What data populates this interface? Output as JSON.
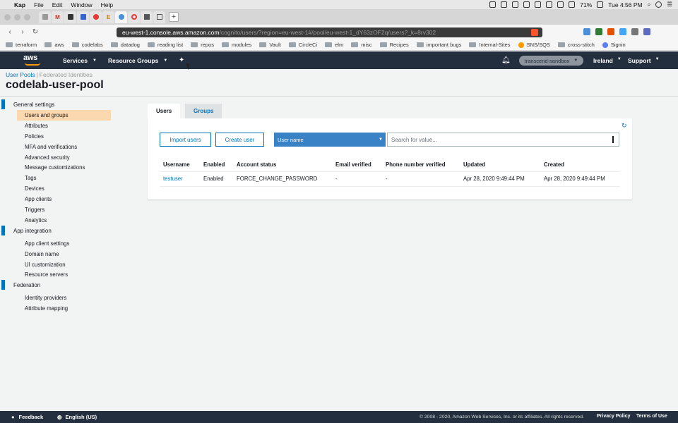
{
  "macos": {
    "menus": [
      "Kap",
      "File",
      "Edit",
      "Window",
      "Help"
    ],
    "battery": "71%",
    "clock": "Tue 4:56 PM"
  },
  "browser": {
    "tabs": [
      "",
      "M",
      "",
      "",
      "",
      "E",
      "",
      "",
      "",
      ""
    ],
    "url_host": "eu-west-1.console.aws.amazon.com",
    "url_path": "/cognito/users/?region=eu-west-1#/pool/eu-west-1_dY63zOF2q/users?_k=8rv302"
  },
  "bookmarks": [
    "terraform",
    "aws",
    "codelabs",
    "datadog",
    "reading list",
    "repos",
    "modules",
    "Vault",
    "CircleCi",
    "elm",
    "misc",
    "Recipes",
    "important bugs",
    "Internal-Sites",
    "SNS/SQS",
    "cross-stitch",
    "Signin"
  ],
  "aws_nav": {
    "services": "Services",
    "resource_groups": "Resource Groups",
    "account": "transcend-sandbox",
    "region": "Ireland",
    "support": "Support"
  },
  "breadcrumbs": {
    "active": "User Pools",
    "inactive": "Federated Identities"
  },
  "pool_title": "codelab-user-pool",
  "sidebar": {
    "general": "General settings",
    "general_items": [
      "Users and groups",
      "Attributes",
      "Policies",
      "MFA and verifications",
      "Advanced security",
      "Message customizations",
      "Tags",
      "Devices",
      "App clients",
      "Triggers",
      "Analytics"
    ],
    "app_integration": "App integration",
    "app_items": [
      "App client settings",
      "Domain name",
      "UI customization",
      "Resource servers"
    ],
    "federation": "Federation",
    "federation_items": [
      "Identity providers",
      "Attribute mapping"
    ]
  },
  "tabs": {
    "users": "Users",
    "groups": "Groups"
  },
  "actions": {
    "import": "Import users",
    "create": "Create user",
    "filter_attr": "User name",
    "search_placeholder": "Search for value..."
  },
  "table": {
    "columns": [
      "Username",
      "Enabled",
      "Account status",
      "Email verified",
      "Phone number verified",
      "Updated",
      "Created"
    ],
    "rows": [
      [
        "testuser",
        "Enabled",
        "FORCE_CHANGE_PASSWORD",
        "-",
        "-",
        "Apr 28, 2020 9:49:44 PM",
        "Apr 28, 2020 9:49:44 PM"
      ]
    ]
  },
  "footer": {
    "feedback": "Feedback",
    "language": "English (US)",
    "copyright": "© 2008 - 2020, Amazon Web Services, Inc. or its affiliates. All rights reserved.",
    "privacy": "Privacy Policy",
    "terms": "Terms of Use"
  }
}
